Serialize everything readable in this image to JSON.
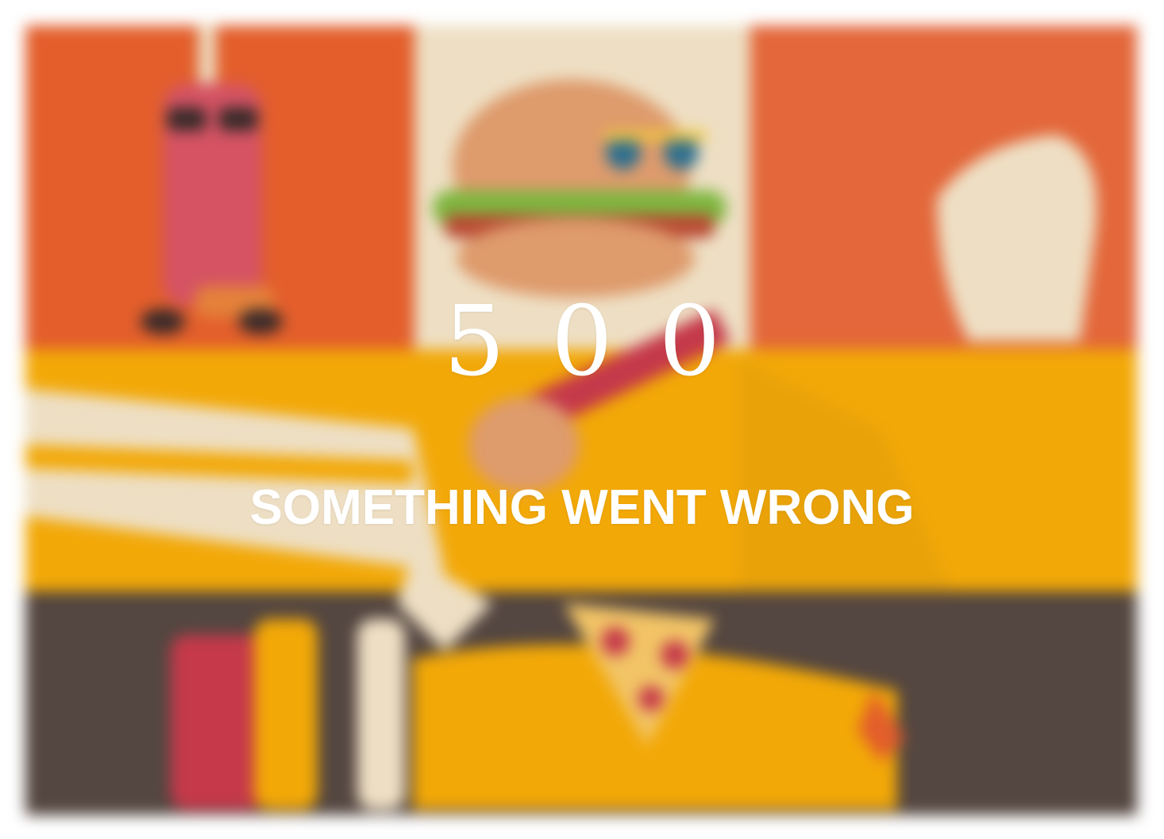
{
  "error": {
    "code": "500",
    "message": "SOMETHING WENT WRONG"
  },
  "background": {
    "illustration_subjects": [
      "soda-cup-character",
      "burger-character",
      "fist",
      "pizza-slice",
      "hand"
    ],
    "colors": {
      "orange": "#E35E2B",
      "cream": "#EEDFC4",
      "yellow": "#F2A807",
      "dark_brown": "#544640",
      "red": "#C5394A",
      "bun": "#DE9B6C"
    }
  }
}
